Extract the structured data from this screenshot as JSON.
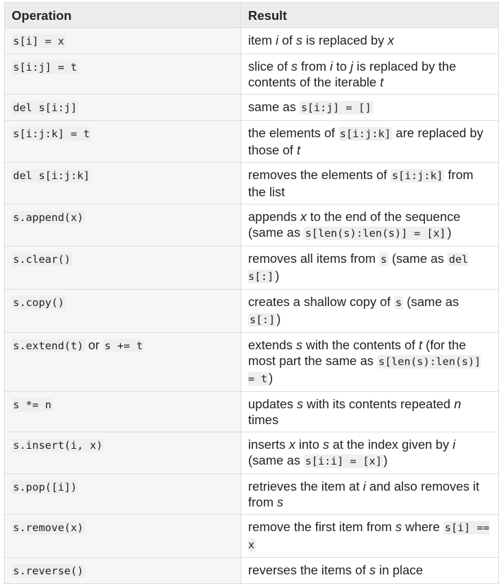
{
  "table": {
    "headers": {
      "operation": "Operation",
      "result": "Result"
    },
    "rows": [
      {
        "operation": [
          {
            "code": "s[i] = x"
          }
        ],
        "result": [
          {
            "text": "item "
          },
          {
            "em": "i"
          },
          {
            "text": " of "
          },
          {
            "em": "s"
          },
          {
            "text": " is replaced by "
          },
          {
            "em": "x"
          }
        ]
      },
      {
        "operation": [
          {
            "code": "s[i:j] = t"
          }
        ],
        "result": [
          {
            "text": "slice of "
          },
          {
            "em": "s"
          },
          {
            "text": " from "
          },
          {
            "em": "i"
          },
          {
            "text": " to "
          },
          {
            "em": "j"
          },
          {
            "text": " is replaced by the contents of the iterable "
          },
          {
            "em": "t"
          }
        ]
      },
      {
        "operation": [
          {
            "code": "del s[i:j]"
          }
        ],
        "result": [
          {
            "text": "same as "
          },
          {
            "code": "s[i:j] = []"
          }
        ]
      },
      {
        "operation": [
          {
            "code": "s[i:j:k] = t"
          }
        ],
        "result": [
          {
            "text": "the elements of "
          },
          {
            "code": "s[i:j:k]"
          },
          {
            "text": " are replaced by those of "
          },
          {
            "em": "t"
          }
        ]
      },
      {
        "operation": [
          {
            "code": "del s[i:j:k]"
          }
        ],
        "result": [
          {
            "text": "removes the elements of "
          },
          {
            "code": "s[i:j:k]"
          },
          {
            "text": " from the list"
          }
        ]
      },
      {
        "operation": [
          {
            "code": "s.append(x)"
          }
        ],
        "result": [
          {
            "text": "appends "
          },
          {
            "em": "x"
          },
          {
            "text": " to the end of the sequence (same as "
          },
          {
            "code": "s[len(s):len(s)] = [x]"
          },
          {
            "text": ")"
          }
        ]
      },
      {
        "operation": [
          {
            "code": "s.clear()"
          }
        ],
        "result": [
          {
            "text": "removes all items from "
          },
          {
            "code": "s"
          },
          {
            "text": " (same as "
          },
          {
            "code": "del s[:]"
          },
          {
            "text": ")"
          }
        ]
      },
      {
        "operation": [
          {
            "code": "s.copy()"
          }
        ],
        "result": [
          {
            "text": "creates a shallow copy of "
          },
          {
            "code": "s"
          },
          {
            "text": " (same as "
          },
          {
            "code": "s[:]"
          },
          {
            "text": ")"
          }
        ]
      },
      {
        "operation": [
          {
            "code": "s.extend(t)"
          },
          {
            "text": " or "
          },
          {
            "code": "s += t"
          }
        ],
        "result": [
          {
            "text": "extends "
          },
          {
            "em": "s"
          },
          {
            "text": " with the contents of "
          },
          {
            "em": "t"
          },
          {
            "text": " (for the most part the same as "
          },
          {
            "code": "s[len(s):len(s)] = t"
          },
          {
            "text": ")"
          }
        ]
      },
      {
        "operation": [
          {
            "code": "s *= n"
          }
        ],
        "result": [
          {
            "text": "updates "
          },
          {
            "em": "s"
          },
          {
            "text": " with its contents repeated "
          },
          {
            "em": "n"
          },
          {
            "text": " times"
          }
        ]
      },
      {
        "operation": [
          {
            "code": "s.insert(i, x)"
          }
        ],
        "result": [
          {
            "text": "inserts "
          },
          {
            "em": "x"
          },
          {
            "text": " into "
          },
          {
            "em": "s"
          },
          {
            "text": " at the index given by "
          },
          {
            "em": "i"
          },
          {
            "text": " (same as "
          },
          {
            "code": "s[i:i] = [x]"
          },
          {
            "text": ")"
          }
        ]
      },
      {
        "operation": [
          {
            "code": "s.pop([i])"
          }
        ],
        "result": [
          {
            "text": "retrieves the item at "
          },
          {
            "em": "i"
          },
          {
            "text": " and also removes it from "
          },
          {
            "em": "s"
          }
        ]
      },
      {
        "operation": [
          {
            "code": "s.remove(x)"
          }
        ],
        "result": [
          {
            "text": "remove the first item from "
          },
          {
            "em": "s"
          },
          {
            "text": " where "
          },
          {
            "code": "s[i] == x"
          }
        ]
      },
      {
        "operation": [
          {
            "code": "s.reverse()"
          }
        ],
        "result": [
          {
            "text": "reverses the items of "
          },
          {
            "em": "s"
          },
          {
            "text": " in place"
          }
        ]
      }
    ]
  }
}
